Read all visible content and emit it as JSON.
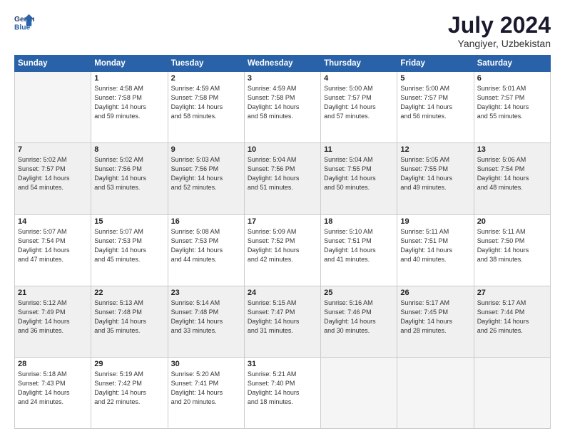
{
  "logo": {
    "line1": "General",
    "line2": "Blue"
  },
  "title": "July 2024",
  "location": "Yangiyer, Uzbekistan",
  "headers": [
    "Sunday",
    "Monday",
    "Tuesday",
    "Wednesday",
    "Thursday",
    "Friday",
    "Saturday"
  ],
  "weeks": [
    [
      {
        "day": "",
        "detail": ""
      },
      {
        "day": "1",
        "detail": "Sunrise: 4:58 AM\nSunset: 7:58 PM\nDaylight: 14 hours\nand 59 minutes."
      },
      {
        "day": "2",
        "detail": "Sunrise: 4:59 AM\nSunset: 7:58 PM\nDaylight: 14 hours\nand 58 minutes."
      },
      {
        "day": "3",
        "detail": "Sunrise: 4:59 AM\nSunset: 7:58 PM\nDaylight: 14 hours\nand 58 minutes."
      },
      {
        "day": "4",
        "detail": "Sunrise: 5:00 AM\nSunset: 7:57 PM\nDaylight: 14 hours\nand 57 minutes."
      },
      {
        "day": "5",
        "detail": "Sunrise: 5:00 AM\nSunset: 7:57 PM\nDaylight: 14 hours\nand 56 minutes."
      },
      {
        "day": "6",
        "detail": "Sunrise: 5:01 AM\nSunset: 7:57 PM\nDaylight: 14 hours\nand 55 minutes."
      }
    ],
    [
      {
        "day": "7",
        "detail": "Sunrise: 5:02 AM\nSunset: 7:57 PM\nDaylight: 14 hours\nand 54 minutes."
      },
      {
        "day": "8",
        "detail": "Sunrise: 5:02 AM\nSunset: 7:56 PM\nDaylight: 14 hours\nand 53 minutes."
      },
      {
        "day": "9",
        "detail": "Sunrise: 5:03 AM\nSunset: 7:56 PM\nDaylight: 14 hours\nand 52 minutes."
      },
      {
        "day": "10",
        "detail": "Sunrise: 5:04 AM\nSunset: 7:56 PM\nDaylight: 14 hours\nand 51 minutes."
      },
      {
        "day": "11",
        "detail": "Sunrise: 5:04 AM\nSunset: 7:55 PM\nDaylight: 14 hours\nand 50 minutes."
      },
      {
        "day": "12",
        "detail": "Sunrise: 5:05 AM\nSunset: 7:55 PM\nDaylight: 14 hours\nand 49 minutes."
      },
      {
        "day": "13",
        "detail": "Sunrise: 5:06 AM\nSunset: 7:54 PM\nDaylight: 14 hours\nand 48 minutes."
      }
    ],
    [
      {
        "day": "14",
        "detail": "Sunrise: 5:07 AM\nSunset: 7:54 PM\nDaylight: 14 hours\nand 47 minutes."
      },
      {
        "day": "15",
        "detail": "Sunrise: 5:07 AM\nSunset: 7:53 PM\nDaylight: 14 hours\nand 45 minutes."
      },
      {
        "day": "16",
        "detail": "Sunrise: 5:08 AM\nSunset: 7:53 PM\nDaylight: 14 hours\nand 44 minutes."
      },
      {
        "day": "17",
        "detail": "Sunrise: 5:09 AM\nSunset: 7:52 PM\nDaylight: 14 hours\nand 42 minutes."
      },
      {
        "day": "18",
        "detail": "Sunrise: 5:10 AM\nSunset: 7:51 PM\nDaylight: 14 hours\nand 41 minutes."
      },
      {
        "day": "19",
        "detail": "Sunrise: 5:11 AM\nSunset: 7:51 PM\nDaylight: 14 hours\nand 40 minutes."
      },
      {
        "day": "20",
        "detail": "Sunrise: 5:11 AM\nSunset: 7:50 PM\nDaylight: 14 hours\nand 38 minutes."
      }
    ],
    [
      {
        "day": "21",
        "detail": "Sunrise: 5:12 AM\nSunset: 7:49 PM\nDaylight: 14 hours\nand 36 minutes."
      },
      {
        "day": "22",
        "detail": "Sunrise: 5:13 AM\nSunset: 7:48 PM\nDaylight: 14 hours\nand 35 minutes."
      },
      {
        "day": "23",
        "detail": "Sunrise: 5:14 AM\nSunset: 7:48 PM\nDaylight: 14 hours\nand 33 minutes."
      },
      {
        "day": "24",
        "detail": "Sunrise: 5:15 AM\nSunset: 7:47 PM\nDaylight: 14 hours\nand 31 minutes."
      },
      {
        "day": "25",
        "detail": "Sunrise: 5:16 AM\nSunset: 7:46 PM\nDaylight: 14 hours\nand 30 minutes."
      },
      {
        "day": "26",
        "detail": "Sunrise: 5:17 AM\nSunset: 7:45 PM\nDaylight: 14 hours\nand 28 minutes."
      },
      {
        "day": "27",
        "detail": "Sunrise: 5:17 AM\nSunset: 7:44 PM\nDaylight: 14 hours\nand 26 minutes."
      }
    ],
    [
      {
        "day": "28",
        "detail": "Sunrise: 5:18 AM\nSunset: 7:43 PM\nDaylight: 14 hours\nand 24 minutes."
      },
      {
        "day": "29",
        "detail": "Sunrise: 5:19 AM\nSunset: 7:42 PM\nDaylight: 14 hours\nand 22 minutes."
      },
      {
        "day": "30",
        "detail": "Sunrise: 5:20 AM\nSunset: 7:41 PM\nDaylight: 14 hours\nand 20 minutes."
      },
      {
        "day": "31",
        "detail": "Sunrise: 5:21 AM\nSunset: 7:40 PM\nDaylight: 14 hours\nand 18 minutes."
      },
      {
        "day": "",
        "detail": ""
      },
      {
        "day": "",
        "detail": ""
      },
      {
        "day": "",
        "detail": ""
      }
    ]
  ]
}
